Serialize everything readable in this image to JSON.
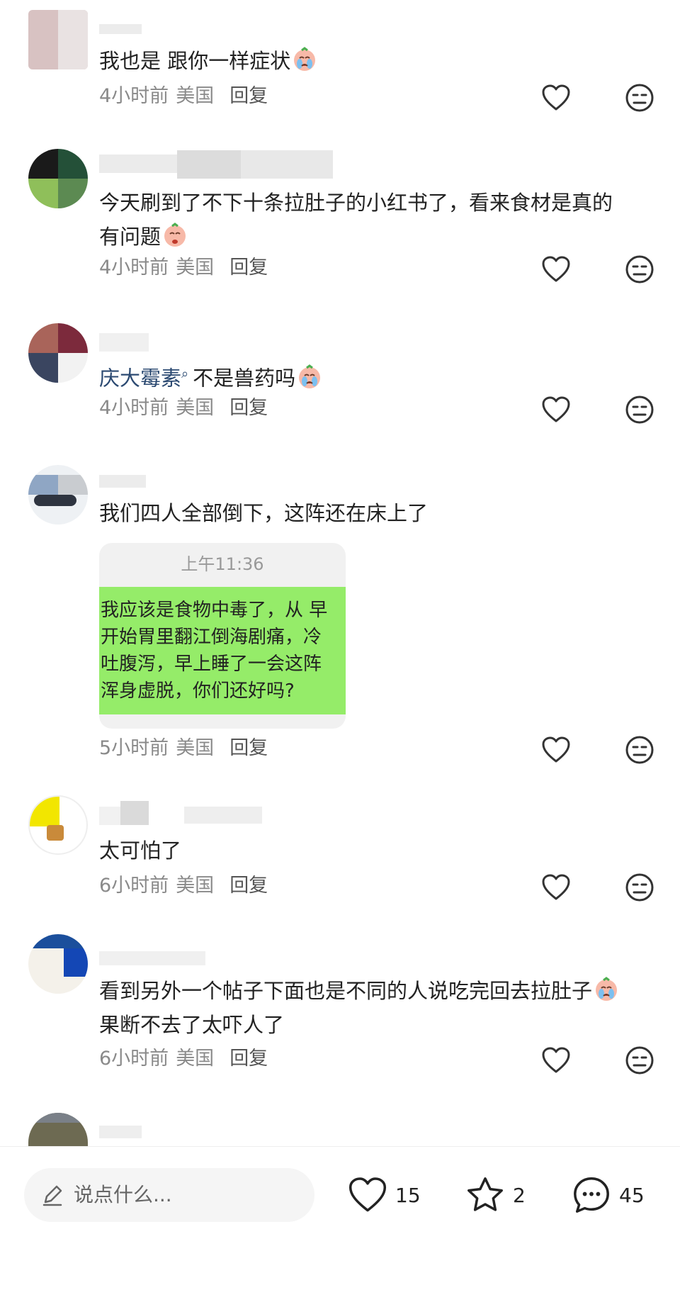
{
  "comments": [
    {
      "text_parts": [
        "我也是 跟你一样症状"
      ],
      "time": "4小时前",
      "location": "美国",
      "reply": "回复"
    },
    {
      "text_parts": [
        "今天刷到了不下十条拉肚子的小红书了，看来食材是真的",
        "有问题"
      ],
      "time": "4小时前",
      "location": "美国",
      "reply": "回复"
    },
    {
      "tag": "庆大霉素",
      "text_parts": [
        "不是兽药吗"
      ],
      "time": "4小时前",
      "location": "美国",
      "reply": "回复"
    },
    {
      "text_parts": [
        "我们四人全部倒下，这阵还在床上了"
      ],
      "time": "5小时前",
      "location": "美国",
      "reply": "回复",
      "screenshot": {
        "time": "上午11:36",
        "lines": [
          "我应该是食物中毒了，从 早",
          "开始胃里翻江倒海剧痛，冷",
          "吐腹泻，早上睡了一会这阵",
          "浑身虚脱，你们还好吗?"
        ]
      }
    },
    {
      "text_parts": [
        "太可怕了"
      ],
      "time": "6小时前",
      "location": "美国",
      "reply": "回复"
    },
    {
      "text_parts": [
        "看到另外一个帖子下面也是不同的人说吃完回去拉肚子",
        "果断不去了太吓人了"
      ],
      "time": "6小时前",
      "location": "美国",
      "reply": "回复"
    }
  ],
  "bottom_bar": {
    "input_placeholder": "说点什么...",
    "likes": "15",
    "stars": "2",
    "comments": "45"
  },
  "icons": {
    "like": "heart-outline-icon",
    "face": "neutral-face-icon",
    "pencil": "pencil-icon",
    "star": "star-outline-icon",
    "comment": "speech-bubble-icon",
    "emoji_cry": "crying-face-emoji"
  },
  "colors": {
    "tag": "#2c4a72",
    "chat_bubble": "#95ec69",
    "meta": "#8a8a8a"
  }
}
